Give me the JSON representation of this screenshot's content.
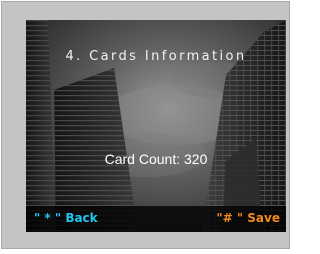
{
  "screen": {
    "title": "4. Cards Information",
    "card_count_text": "Card Count: 320"
  },
  "footer": {
    "back_label": "\" * \" Back",
    "save_label": "\"# \" Save"
  },
  "colors": {
    "back_accent": "#1fc6ee",
    "save_accent": "#f28a1d",
    "text": "#ffffff"
  },
  "icons": {
    "background": "city-skyscrapers-background"
  }
}
